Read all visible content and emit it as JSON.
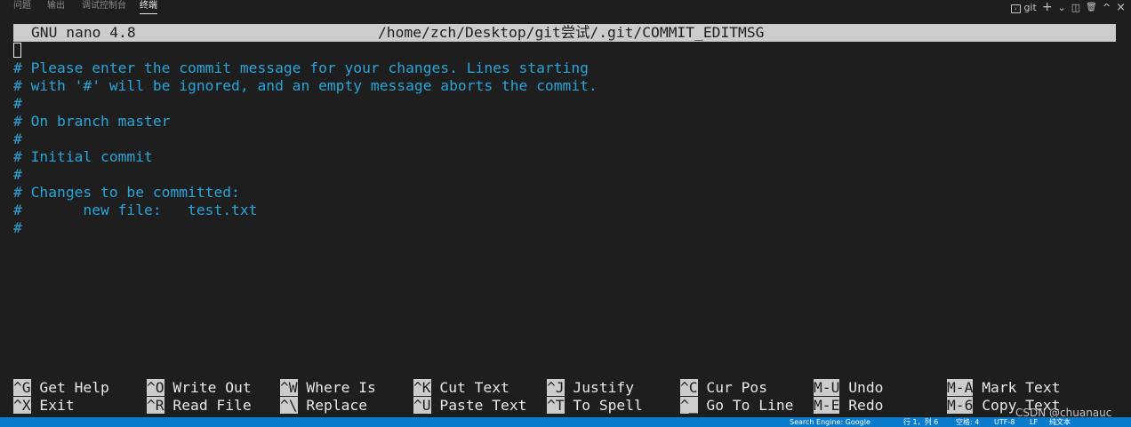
{
  "tabs": [
    {
      "label": "问题",
      "active": false
    },
    {
      "label": "输出",
      "active": false
    },
    {
      "label": "调试控制台",
      "active": false
    },
    {
      "label": "终端",
      "active": true
    }
  ],
  "toolbar": {
    "shell_label": "git",
    "add_glyph": "+",
    "dropdown_glyph": "⌄",
    "split_glyph": "◫",
    "trash_glyph": "🗑",
    "maximize_glyph": "^",
    "close_glyph": "×"
  },
  "nano": {
    "version": "GNU nano 4.8",
    "path": "/home/zch/Desktop/git尝试/.git/COMMIT_EDITMSG",
    "lines": [
      "# Please enter the commit message for your changes. Lines starting",
      "# with '#' will be ignored, and an empty message aborts the commit.",
      "#",
      "# On branch master",
      "#",
      "# Initial commit",
      "#",
      "# Changes to be committed:",
      "#       new file:   test.txt",
      "#"
    ],
    "shortcuts": [
      [
        {
          "key": "^G",
          "label": "Get Help"
        },
        {
          "key": "^O",
          "label": "Write Out"
        },
        {
          "key": "^W",
          "label": "Where Is"
        },
        {
          "key": "^K",
          "label": "Cut Text"
        },
        {
          "key": "^J",
          "label": "Justify"
        },
        {
          "key": "^C",
          "label": "Cur Pos"
        },
        {
          "key": "M-U",
          "label": "Undo"
        },
        {
          "key": "M-A",
          "label": "Mark Text"
        }
      ],
      [
        {
          "key": "^X",
          "label": "Exit"
        },
        {
          "key": "^R",
          "label": "Read File"
        },
        {
          "key": "^\\",
          "label": "Replace"
        },
        {
          "key": "^U",
          "label": "Paste Text"
        },
        {
          "key": "^T",
          "label": "To Spell"
        },
        {
          "key": "^_",
          "label": "Go To Line"
        },
        {
          "key": "M-E",
          "label": "Redo"
        },
        {
          "key": "M-6",
          "label": "Copy Text"
        }
      ]
    ]
  },
  "statusbar": {
    "search_engine": "Search Engine: Google",
    "position": "行 1，列 6",
    "spaces": "空格: 4",
    "encoding": "UTF-8",
    "eol": "LF",
    "language": "纯文本"
  },
  "watermark": "CSDN @chuanauc",
  "colors": {
    "background": "#1e1e1e",
    "comment_text": "#29a4d8",
    "titlebar_bg": "#cccccc",
    "statusbar_bg": "#0b7bcc"
  }
}
